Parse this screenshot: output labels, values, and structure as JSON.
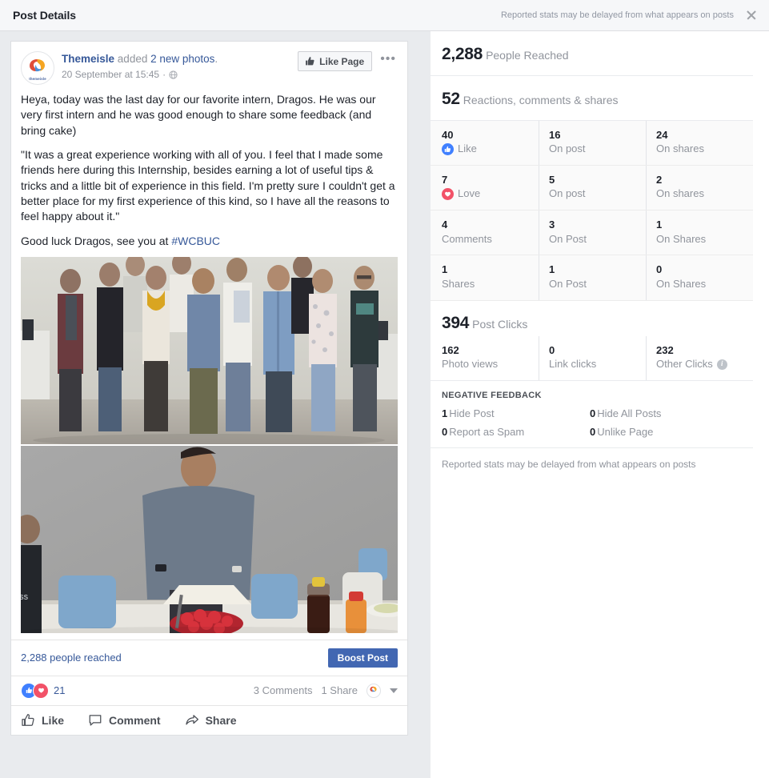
{
  "topbar": {
    "title": "Post Details",
    "note": "Reported stats may be delayed from what appears on posts",
    "close_label": "×"
  },
  "post": {
    "page_name": "Themeisle",
    "action_text": "added",
    "photos_link": "2 new photos",
    "trailing_period": ".",
    "timestamp": "20 September at 15:45",
    "privacy": "public-globe-icon",
    "like_page_label": "Like Page",
    "more_options_label": "•••",
    "avatar_brand": "themeisle",
    "body_paragraphs": [
      "Heya, today was the last day for our favorite intern, Dragos. He was our very first intern and he was good enough to share some feedback (and bring cake)",
      "\"It was a great experience working with all of you. I feel that I made some friends here during this Internship, besides earning a lot of useful tips & tricks and a little bit of experience in this field. I'm pretty sure I couldn't get a better place for my first experience of this kind, so I have all the reasons to feel happy about it.\""
    ],
    "closing_text": "Good luck Dragos, see you at ",
    "hashtag": "#WCBUC",
    "photos": [
      {
        "alt": "Team group photo of eleven people standing in an office"
      },
      {
        "alt": "Young man cutting a strawberry cake at an office table"
      }
    ],
    "reach_text": "2,288 people reached",
    "boost_label": "Boost Post",
    "reaction_count": "21",
    "comments_text": "3 Comments",
    "shares_text": "1 Share",
    "actions": [
      {
        "label": "Like",
        "icon": "thumbs-up-icon"
      },
      {
        "label": "Comment",
        "icon": "comment-bubble-icon"
      },
      {
        "label": "Share",
        "icon": "share-arrow-icon"
      }
    ]
  },
  "stats": {
    "people_reached": {
      "value": "2,288",
      "label": "People Reached"
    },
    "engagement": {
      "value": "52",
      "label": "Reactions, comments & shares"
    },
    "rows": [
      {
        "icon": "like-icon",
        "total": "40",
        "total_label": "Like",
        "on_post": "16",
        "on_post_label": "On post",
        "on_shares": "24",
        "on_shares_label": "On shares"
      },
      {
        "icon": "love-icon",
        "total": "7",
        "total_label": "Love",
        "on_post": "5",
        "on_post_label": "On post",
        "on_shares": "2",
        "on_shares_label": "On shares"
      },
      {
        "icon": "none",
        "total": "4",
        "total_label": "Comments",
        "on_post": "3",
        "on_post_label": "On Post",
        "on_shares": "1",
        "on_shares_label": "On Shares"
      },
      {
        "icon": "none",
        "total": "1",
        "total_label": "Shares",
        "on_post": "1",
        "on_post_label": "On Post",
        "on_shares": "0",
        "on_shares_label": "On Shares"
      }
    ],
    "post_clicks": {
      "value": "394",
      "label": "Post Clicks"
    },
    "clicks_row": {
      "photo_views": "162",
      "photo_views_label": "Photo views",
      "link_clicks": "0",
      "link_clicks_label": "Link clicks",
      "other_clicks": "232",
      "other_clicks_label": "Other Clicks"
    },
    "negative_feedback": {
      "title": "NEGATIVE FEEDBACK",
      "items": [
        {
          "count": "1",
          "label": "Hide Post"
        },
        {
          "count": "0",
          "label": "Hide All Posts"
        },
        {
          "count": "0",
          "label": "Report as Spam"
        },
        {
          "count": "0",
          "label": "Unlike Page"
        }
      ]
    },
    "footer_note": "Reported stats may be delayed from what appears on posts"
  },
  "colors": {
    "brand_blue": "#4267b2",
    "link_blue": "#365899",
    "like_blue": "#4080ff",
    "love_red": "#f25268",
    "muted_gray": "#90949c",
    "page_bg": "#e9ebee"
  }
}
